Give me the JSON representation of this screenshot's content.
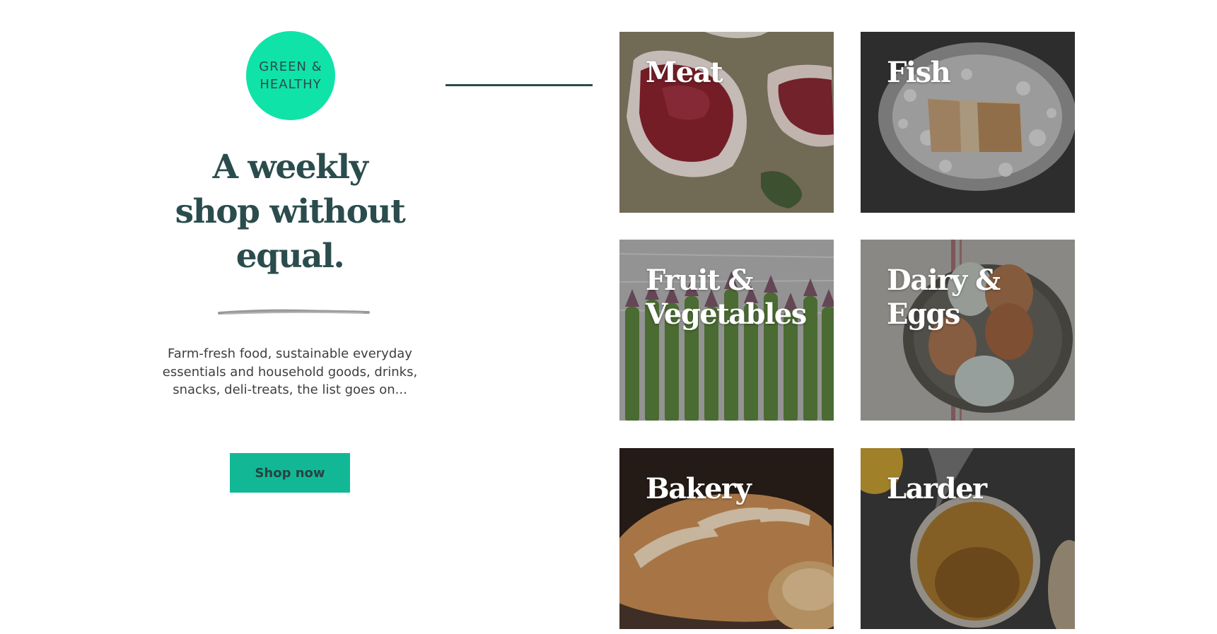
{
  "badge": {
    "line1": "GREEN &",
    "line2": "HEALTHY"
  },
  "hero": {
    "headline_line1": "A weekly",
    "headline_line2": "shop without",
    "headline_line3": "equal.",
    "description": "Farm-fresh food, sustainable everyday essentials and household goods, drinks, snacks, deli-treats, the list goes on...",
    "button_label": "Shop now"
  },
  "categories": [
    {
      "line1": "Meat",
      "line2": ""
    },
    {
      "line1": "Fish",
      "line2": ""
    },
    {
      "line1": "Fruit &",
      "line2": "Vegetables"
    },
    {
      "line1": "Dairy &",
      "line2": "Eggs"
    },
    {
      "line1": "Bakery",
      "line2": ""
    },
    {
      "line1": "Larder",
      "line2": ""
    }
  ],
  "colors": {
    "brand_green": "#0fe3a8",
    "button_teal": "#12b896",
    "heading_dark": "#2b4c4c"
  }
}
